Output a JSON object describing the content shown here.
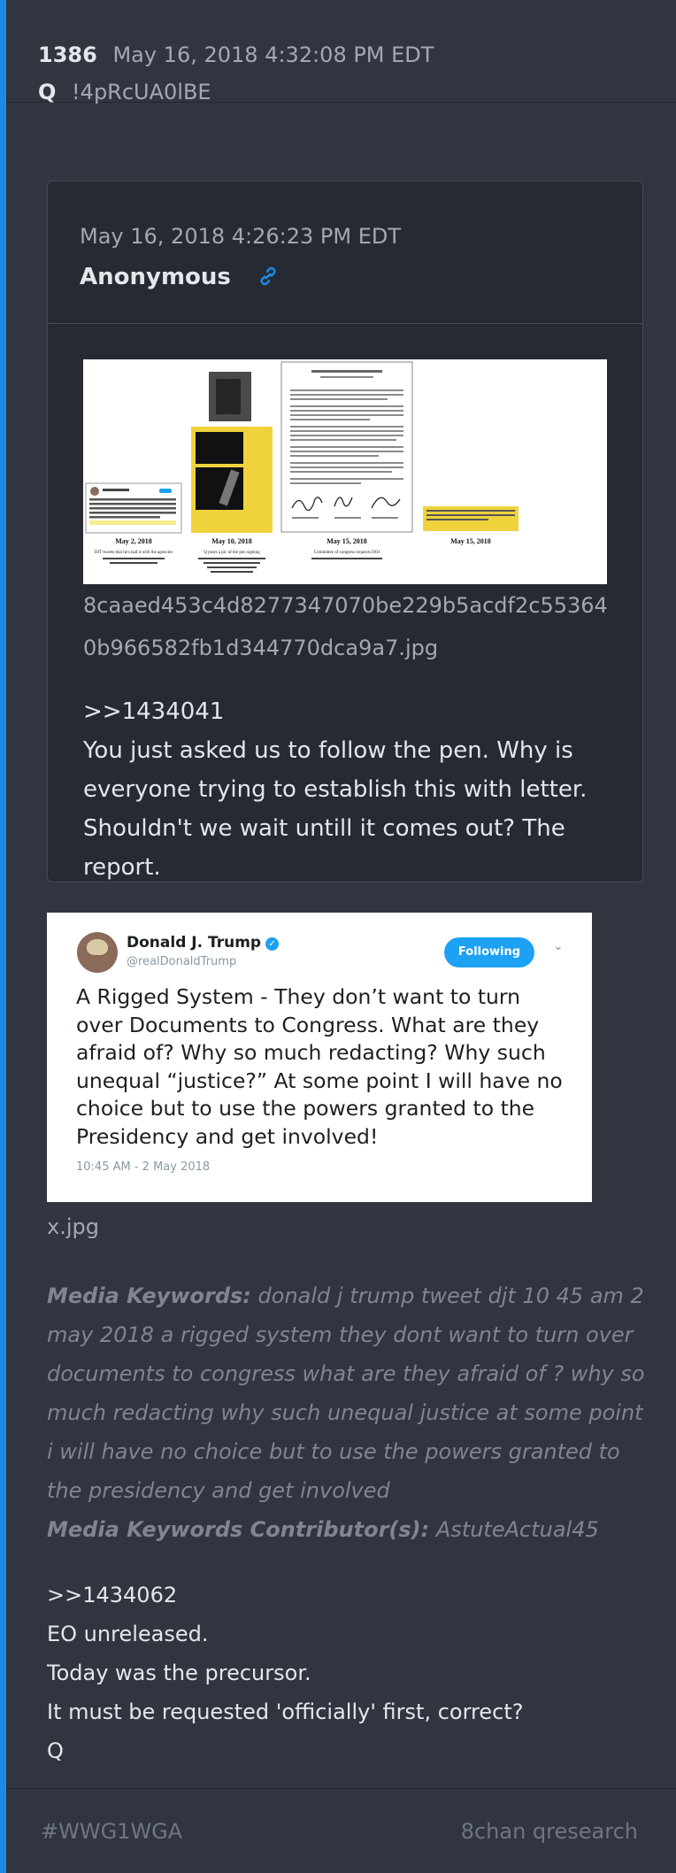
{
  "post": {
    "number": "1386",
    "date": "May 16, 2018 4:32:08 PM EDT",
    "author": "Q",
    "tripcode": "!4pRcUA0lBE"
  },
  "quoted_post": {
    "date": "May 16, 2018 4:26:23 PM EDT",
    "author": "Anonymous",
    "image": {
      "filename": "8caaed453c4d8277347070be229b5acdf2c553640b966582fb1d344770dca9a7.jpg",
      "captions": [
        "May 2, 2018",
        "May 10, 2018",
        "May 15, 2018",
        "May 15, 2018"
      ],
      "caption_subs": [
        "DJT tweets that he's had it with the agencies",
        "Q posts a pic of the pen signing",
        "Committee of congress requests DOJ"
      ]
    },
    "lines": [
      ">>1434041",
      "You just asked us to follow the pen. Why is everyone trying to establish this with letter.",
      "Shouldn't we wait untill it comes out? The report."
    ]
  },
  "tweet_image": {
    "name": "Donald J. Trump",
    "handle": "@realDonaldTrump",
    "follow_label": "Following",
    "text": "A Rigged System - They don’t want to turn over Documents to Congress. What are they afraid of? Why so much redacting? Why such unequal “justice?” At some point I will have no choice but to use the powers granted to the Presidency and get involved!",
    "timestamp": "10:45 AM - 2 May 2018",
    "filename": "x.jpg"
  },
  "media_keywords": {
    "label": "Media Keywords:",
    "value": "donald j trump tweet djt 10 45 am 2 may 2018 a rigged system they dont want to turn over documents to congress what are they afraid of ? why so much redacting why such unequal justice at some point i will have no choice but to use the powers granted to the presidency and get involved",
    "contributor_label": "Media Keywords Contributor(s):",
    "contributor": "AstuteActual45"
  },
  "message": {
    "lines": [
      ">>1434062",
      "EO unreleased.",
      "Today was the precursor.",
      "It must be requested 'officially' first, correct?",
      "Q"
    ]
  },
  "footer": {
    "hashtag": "#WWG1WGA",
    "source": "8chan qresearch"
  },
  "colors": {
    "accent": "#1e88e5",
    "background": "#303540",
    "card": "#262a33"
  }
}
